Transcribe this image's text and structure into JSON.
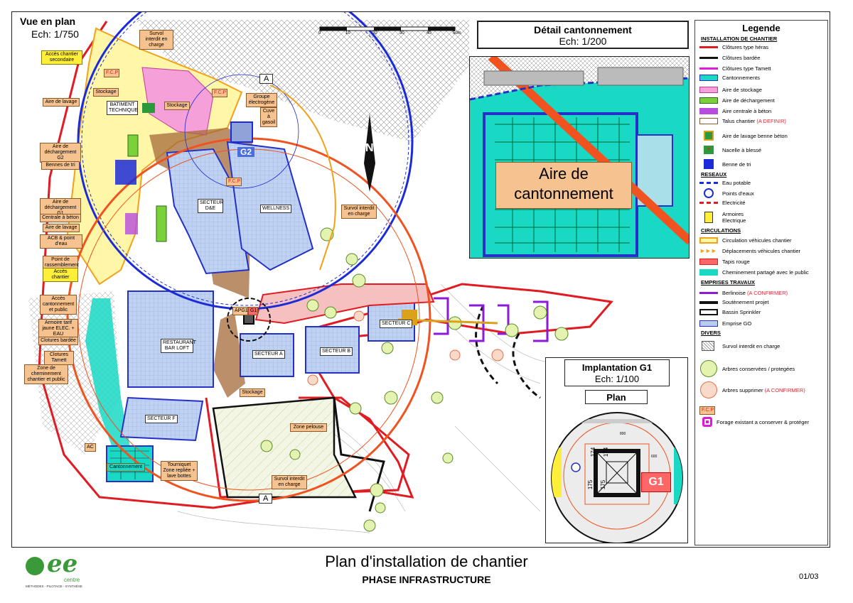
{
  "plan": {
    "title": "Vue en plan",
    "scale": "Ech: 1/750",
    "scale_bar": [
      "0",
      "10",
      "20",
      "30",
      "40",
      "50m"
    ],
    "north": "N",
    "labels": {
      "acces_secondaire": "Accès chantier secondaire",
      "survol_top": "Survol interdit en charge",
      "fcp1": "F.C.P",
      "fcp2": "F.C.P",
      "fcp3": "F.C.P",
      "stockage1": "Stockage",
      "stockage2": "Stockage",
      "stockage3": "Stockage",
      "batiment": "BATIMENT TECHNIQUE",
      "groupe": "Groupe électrogène",
      "cuve": "Cuve à gasoil",
      "aire_lavage": "Aire de lavage",
      "aire_dech_g2": "Aire de déchargement G2",
      "bennes": "Bennes de tri",
      "g2": "G2",
      "aire_dech_g1": "Aire de déchargement G1",
      "centrale": "Centrale à béton",
      "aire_lavage2": "Aire de lavage",
      "acb": "ACB & point d'eau",
      "rassemblement": "Point de rassemblement",
      "acces_chantier": "Accès chantier",
      "acces_cant": "Accès cantonnement et public",
      "armoire": "Armoire tarif jaune ELEC. + EAU",
      "clot_bardee": "Clotures bardée",
      "clot_tamett": "Clotures Tamett",
      "zone_chem": "Zone de cheminement chantier et public",
      "ac": "AC",
      "cant": "Cantonnement",
      "tourniquet": "Tourniquet Zone repliée + lave bottes",
      "survol_bottom": "Survol interdit en charge",
      "survol_right": "Survol interdit en charge",
      "zone_pelouse": "Zone pelouse",
      "secteur_de": "SECTEUR D&E",
      "wellness": "WELLNESS",
      "restaurant": "RESTAURANT BAR LOFT",
      "secteur_a": "SECTEUR A",
      "secteur_b": "SECTEUR B",
      "secteur_c": "SECTEUR C",
      "secteur_f": "SECTEUR F",
      "apg1": "APG1",
      "g1": "G1",
      "marker_a1": "A",
      "marker_a2": "A"
    }
  },
  "detail": {
    "title": "Détail cantonnement",
    "scale": "Ech:  1/200",
    "label": "Aire de cantonnement"
  },
  "implantation": {
    "title": "Implantation G1",
    "scale": "Ech:  1/100",
    "plan": "Plan",
    "g1": "G1",
    "dims": [
      "174",
      "175",
      "174",
      "175",
      "800",
      "600"
    ]
  },
  "legend": {
    "title": "Legende",
    "sections": {
      "installation": "INSTALLATION DE CHANTIER",
      "reseaux": "RESEAUX",
      "circulations": "CIRCULATIONS",
      "emprises": "EMPRISES TRAVAUX",
      "divers": "DIVERS"
    },
    "items": {
      "clot_heras": "Clôtures type héras",
      "clot_bardee": "Clôtures bardée",
      "clot_tamett": "Clôtures type Tamett",
      "cantonnements": "Cantonnements",
      "aire_stockage": "Aire de stockage",
      "aire_dech": "Aire de déchargement",
      "aire_beton": "Aire centrale à béton",
      "talus": "Talus chantier",
      "talus_note": "(A DEFINIR)",
      "lavage": "Aire de lavage benne béton",
      "nacelle": "Nacelle à blessé",
      "benne": "Benne de tri",
      "eau": "Eau potable",
      "points_eau": "Points d'eaux",
      "elec": "Electricité",
      "armoires": "Armoires Electrique",
      "circ_veh": "Circulation véhicules chantier",
      "depl_veh": "Déplacements véhicules chantier",
      "tapis": "Tapis rouge",
      "chem_public": "Cheminement partagé avec le public",
      "berlinoise": "Berlinoise",
      "berlinoise_note": "(A CONFIRMER)",
      "soutenement": "Soutènement projet",
      "sprinkler": "Bassin Sprinkler",
      "emprise_go": "Emprise GO",
      "survol": "Survol interdit en charge",
      "arbres_cons": "Arbres conservées / protegées",
      "arbres_supp": "Arbres supprimer",
      "arbres_supp_note": "(A CONFIRMER)",
      "fcp": "F.C.P",
      "forage": "Forage existant a conserver & protéger"
    }
  },
  "footer": {
    "title": "Plan d'installation de chantier",
    "subtitle": "PHASE INFRASTRUCTURE",
    "page": "01/03",
    "logo": "ee",
    "logo_sub": "centre",
    "logo_tag": "MÉTHODES - PILOTAGE - SYNTHÈSE"
  },
  "colors": {
    "cantonnement": "#1ad9c4",
    "stockage": "#f5a0d8",
    "dechargement": "#7bd13a",
    "beton": "#b84be0",
    "emprise": "#b8cdf0",
    "crane_g2": "#1c2bd8",
    "crane_g1": "#f0531f",
    "boundary": "#e11b22",
    "talus": "#8b5a2b"
  }
}
